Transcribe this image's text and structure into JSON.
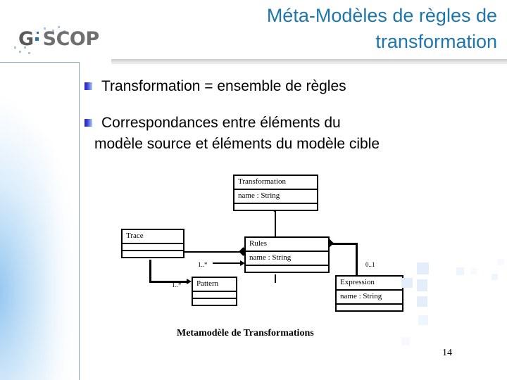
{
  "slide": {
    "page_number": "14",
    "title": "Méta-Modèles de règles de transformation",
    "title_line1": "Méta-Modèles de règles de",
    "title_line2": "transformation",
    "accent_color": "#1f76ad",
    "bullet_color": "#2b1fc0"
  },
  "logo": {
    "name": "G-SCOP",
    "part1": "G",
    "part2": "SCOP"
  },
  "bullets": [
    {
      "marker": "square-bullet",
      "text": "Transformation = ensemble de règles",
      "continuation": ""
    },
    {
      "marker": "square-bullet",
      "text": " Correspondances entre éléments du",
      "continuation": "modèle source et éléments du modèle cible"
    }
  ],
  "diagram": {
    "caption": "Metamodèle de Transformations",
    "classes": [
      {
        "id": "transformation",
        "name": "Transformation",
        "attribute": "name : String",
        "operations": ""
      },
      {
        "id": "trace",
        "name": "Trace",
        "attribute": "",
        "operations": ""
      },
      {
        "id": "rules",
        "name": "Rules",
        "attribute": "name : String",
        "operations": ""
      },
      {
        "id": "pattern",
        "name": "Pattern",
        "attribute": "",
        "operations": ""
      },
      {
        "id": "expression",
        "name": "Expression",
        "attribute": "name : String",
        "operations": ""
      }
    ],
    "multiplicities": [
      {
        "id": "rules-mult",
        "value": "1..*"
      },
      {
        "id": "pattern-mult",
        "value": "1..*"
      },
      {
        "id": "expression-mult",
        "value": "0..1"
      }
    ]
  }
}
